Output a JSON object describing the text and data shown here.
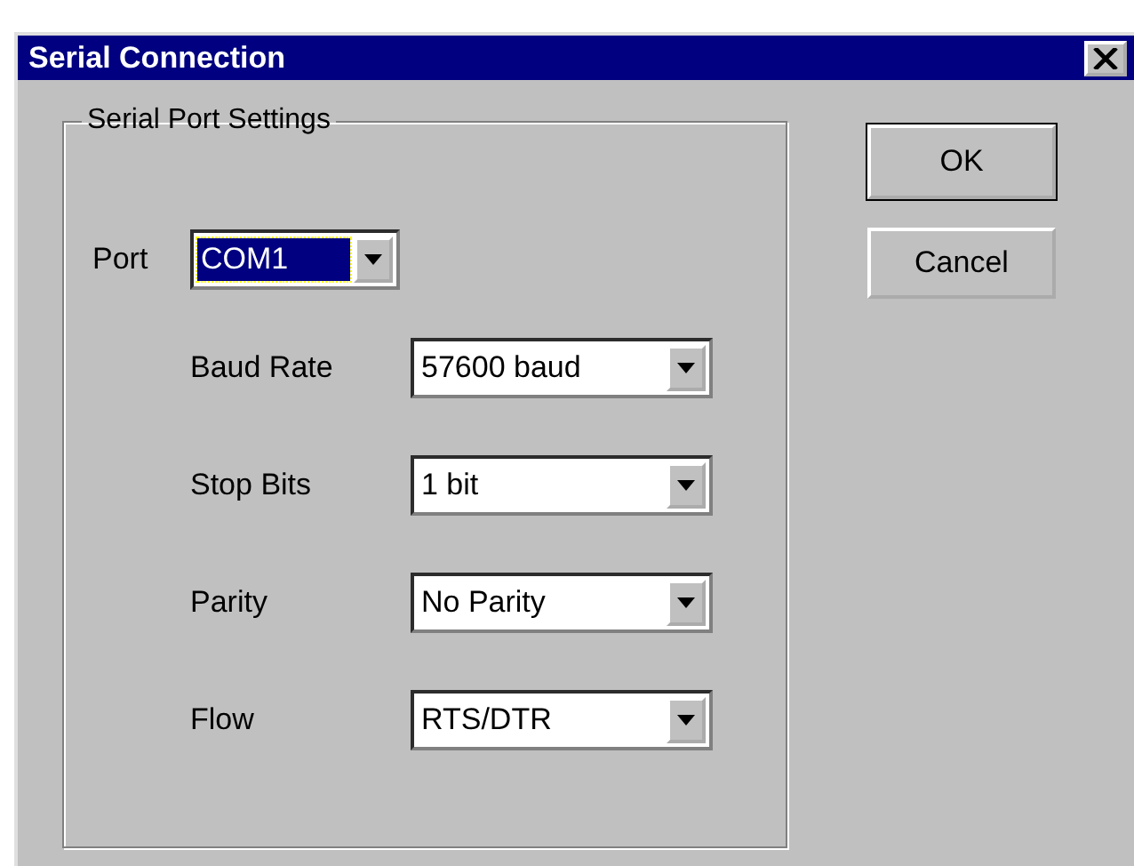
{
  "window": {
    "title": "Serial Connection"
  },
  "group": {
    "title": "Serial Port Settings"
  },
  "port": {
    "label": "Port",
    "value": "COM1",
    "focused": true
  },
  "fields": [
    {
      "label": "Baud Rate",
      "value": "57600 baud",
      "focused": false
    },
    {
      "label": "Stop Bits",
      "value": "1 bit",
      "focused": false
    },
    {
      "label": "Parity",
      "value": "No Parity",
      "focused": false
    },
    {
      "label": "Flow",
      "value": "RTS/DTR",
      "focused": false
    }
  ],
  "buttons": [
    {
      "label": "OK",
      "default": true
    },
    {
      "label": "Cancel",
      "default": false
    }
  ]
}
